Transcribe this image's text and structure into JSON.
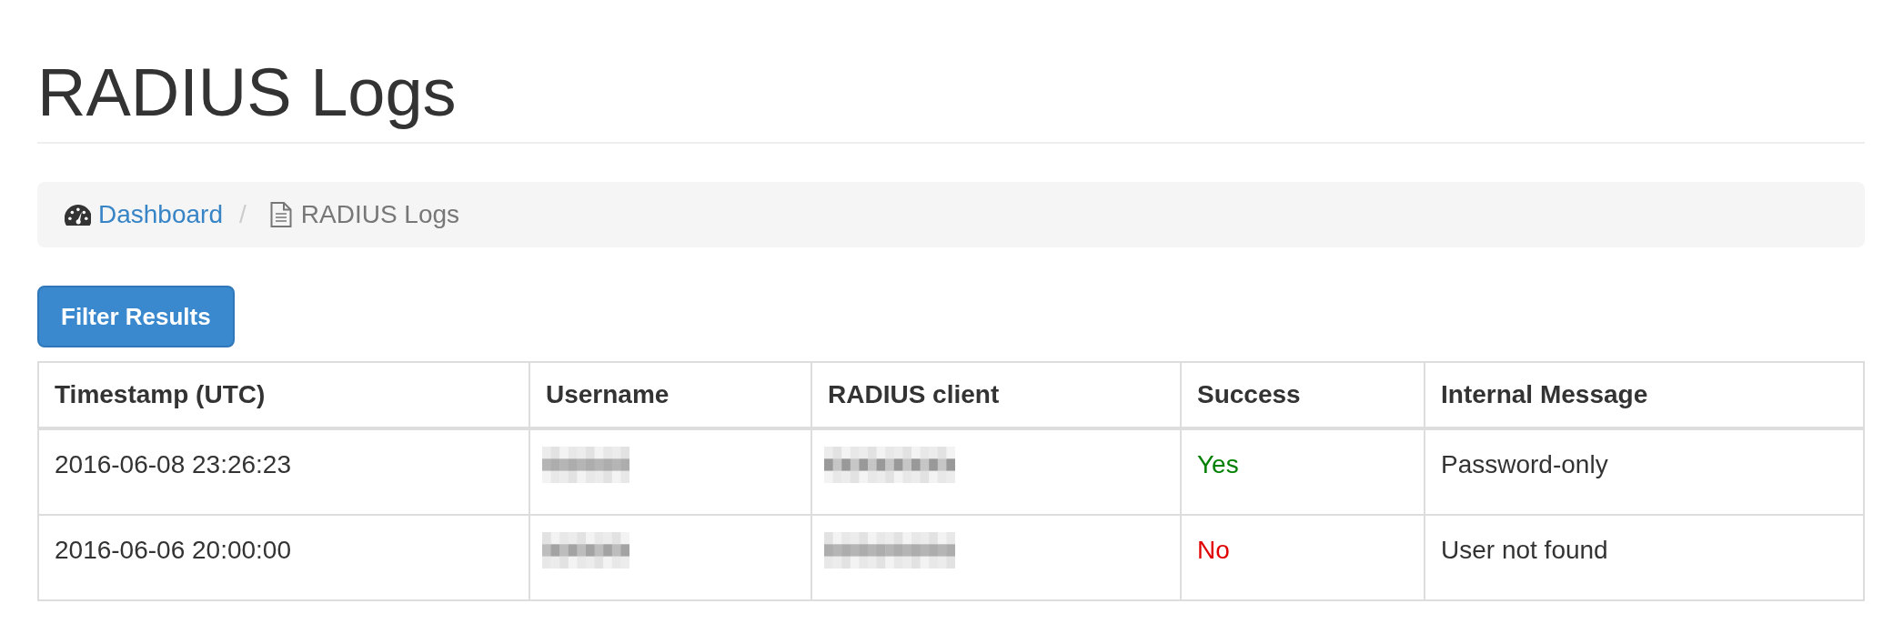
{
  "title": "RADIUS Logs",
  "breadcrumb": {
    "separator": "/",
    "items": [
      {
        "label": "Dashboard",
        "current": false
      },
      {
        "label": "RADIUS Logs",
        "current": true
      }
    ]
  },
  "filter_button": {
    "label": "Filter Results"
  },
  "table": {
    "columns": [
      "Timestamp (UTC)",
      "Username",
      "RADIUS client",
      "Success",
      "Internal Message"
    ],
    "rows": [
      {
        "cells": [
          {
            "kind": "text",
            "text": "2016-06-08 23:26:23"
          },
          {
            "kind": "redacted"
          },
          {
            "kind": "redacted"
          },
          {
            "kind": "status",
            "text": "Yes",
            "color": "#008000"
          },
          {
            "kind": "text",
            "text": "Password-only"
          }
        ]
      },
      {
        "cells": [
          {
            "kind": "text",
            "text": "2016-06-06 20:00:00"
          },
          {
            "kind": "redacted"
          },
          {
            "kind": "redacted"
          },
          {
            "kind": "status",
            "text": "No",
            "color": "#e00000"
          },
          {
            "kind": "text",
            "text": "User not found"
          }
        ]
      }
    ]
  }
}
